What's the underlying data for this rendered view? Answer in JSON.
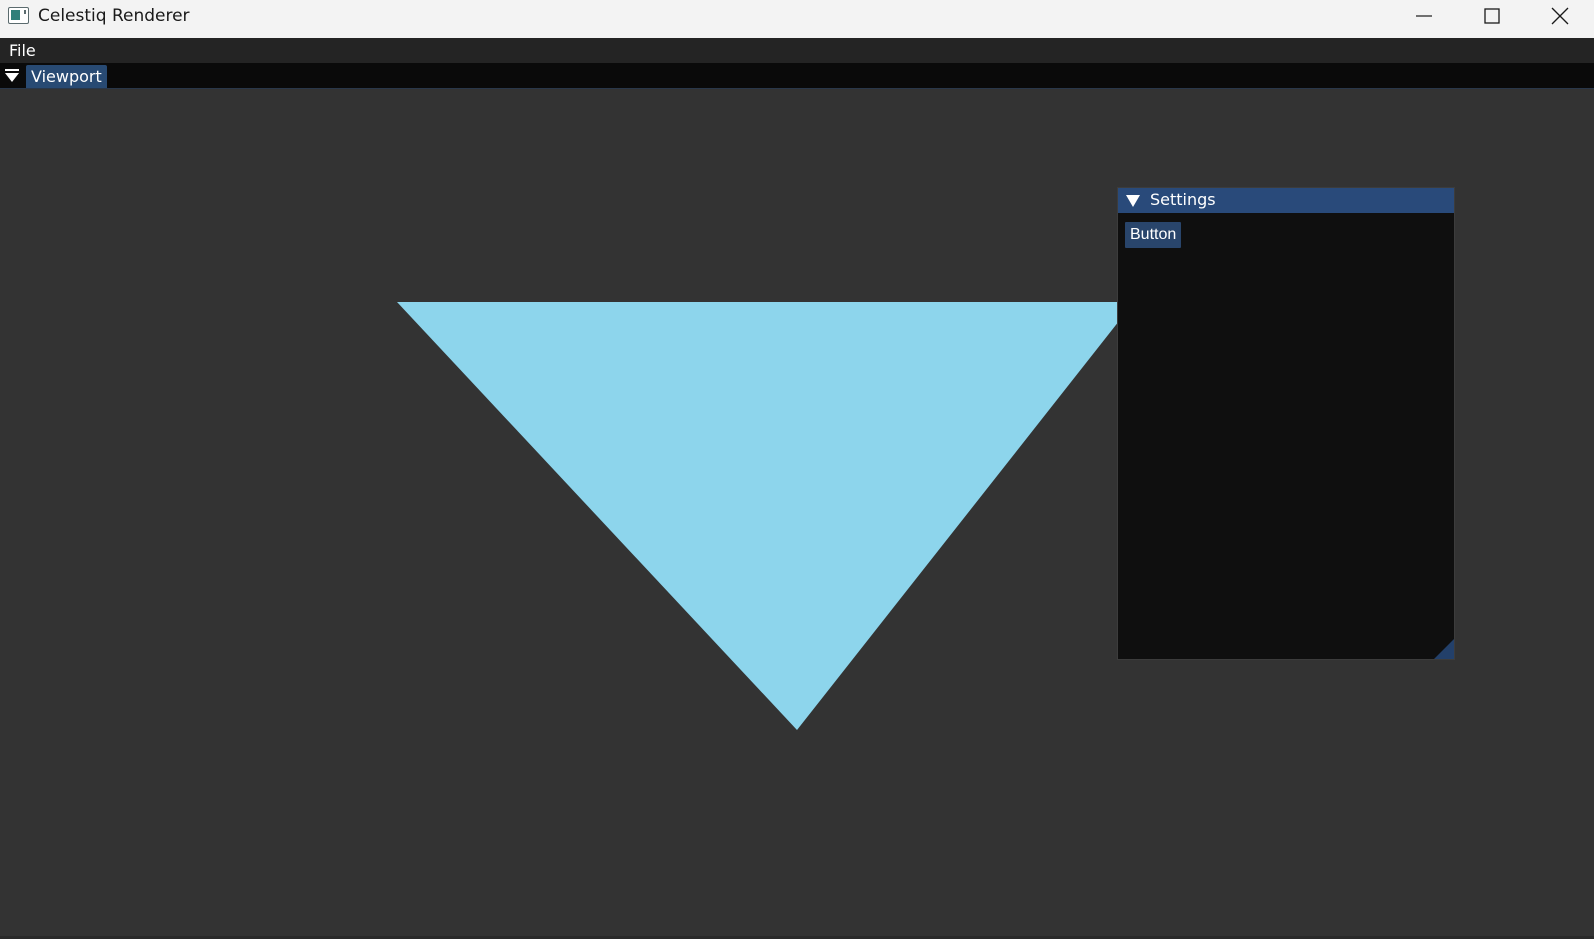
{
  "window": {
    "title": "Celestiq Renderer",
    "icons": {
      "app": "app-window-icon",
      "minimize": "minimize-icon",
      "maximize": "maximize-icon",
      "close": "close-icon"
    }
  },
  "menubar": {
    "items": [
      {
        "label": "File"
      }
    ]
  },
  "dock": {
    "menu_icon": "dock-menu-triangle-icon",
    "tabs": [
      {
        "label": "Viewport",
        "active": true
      }
    ]
  },
  "viewport": {
    "background_color": "#333333",
    "shape": {
      "type": "triangle",
      "orientation": "pointing-down",
      "fill_color": "#8dd5ec"
    }
  },
  "settings_panel": {
    "title": "Settings",
    "collapsed": false,
    "button_label": "Button"
  },
  "colors": {
    "accent": "#294a7a",
    "button": "#29456b",
    "panel_background": "#0f0f0f",
    "menubar": "#242424",
    "tabstrip": "#0a0a0a",
    "titlebar": "#f3f3f3"
  }
}
